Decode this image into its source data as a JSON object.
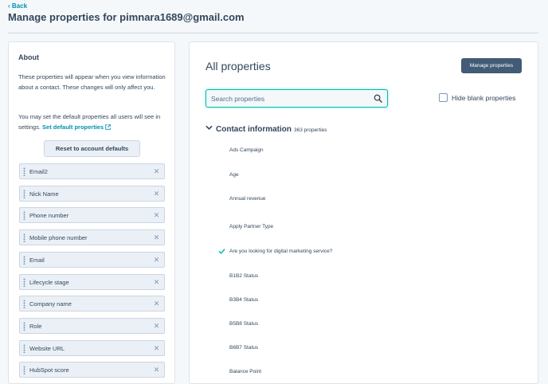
{
  "header": {
    "back_label": "Back",
    "title": "Manage properties for pimnara1689@gmail.com"
  },
  "about": {
    "title": "About",
    "text1": "These properties will appear when you view information about a contact. These changes will only affect you.",
    "text2": "You may set the default properties all users will see in settings.",
    "default_link": "Set default properties",
    "reset_button": "Reset to account defaults",
    "selected_properties": [
      "Email2",
      "Nick Name",
      "Phone number",
      "Mobile phone number",
      "Email",
      "Lifecycle stage",
      "Company name",
      "Role",
      "Website URL",
      "HubSpot score"
    ]
  },
  "all_properties": {
    "title": "All properties",
    "manage_button": "Manage properties",
    "search_placeholder": "Search properties",
    "hide_blank_label": "Hide blank properties",
    "hide_blank_checked": false,
    "section": {
      "title": "Contact information",
      "count": "363 properties",
      "expanded": true,
      "items": [
        {
          "label": "Ads Campaign",
          "checked": false
        },
        {
          "label": "Age",
          "checked": false
        },
        {
          "label": "Annual revenue",
          "checked": false
        },
        {
          "label": "Apply Partner Type",
          "checked": false
        },
        {
          "label": "Are you looking for digital marketing service?",
          "checked": true
        },
        {
          "label": "B1B2 Status",
          "checked": false
        },
        {
          "label": "B3B4 Status",
          "checked": false
        },
        {
          "label": "B5B8 Status",
          "checked": false
        },
        {
          "label": "B6B7 Status",
          "checked": false
        },
        {
          "label": "Balance Point",
          "checked": false
        }
      ]
    }
  },
  "colors": {
    "link": "#0091ae",
    "check": "#00bda5",
    "button_dark": "#425b76"
  }
}
